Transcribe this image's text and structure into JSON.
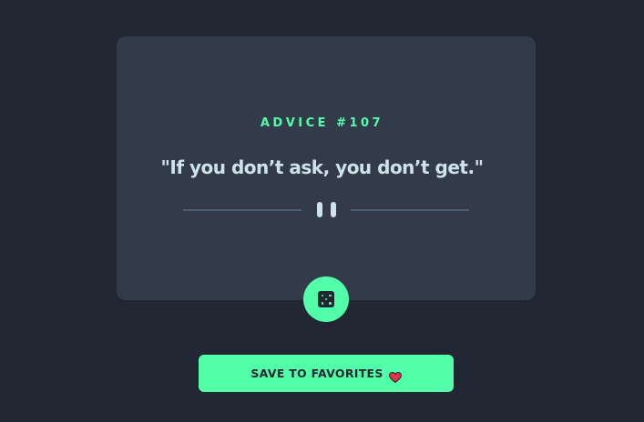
{
  "card": {
    "advice_label": "ADVICE #107",
    "quote": "\"If you don’t ask, you don’t get.\""
  },
  "icons": {
    "divider": "pause-icon",
    "dice": "dice-icon",
    "favorite": "heart-icon"
  },
  "actions": {
    "save_label": "SAVE TO FAVORITES"
  },
  "colors": {
    "background": "#202632",
    "card": "#333a4a",
    "accent": "#52ffa8",
    "text": "#cee3e9",
    "divider": "#4f5d74",
    "heart": "#e0334c"
  }
}
